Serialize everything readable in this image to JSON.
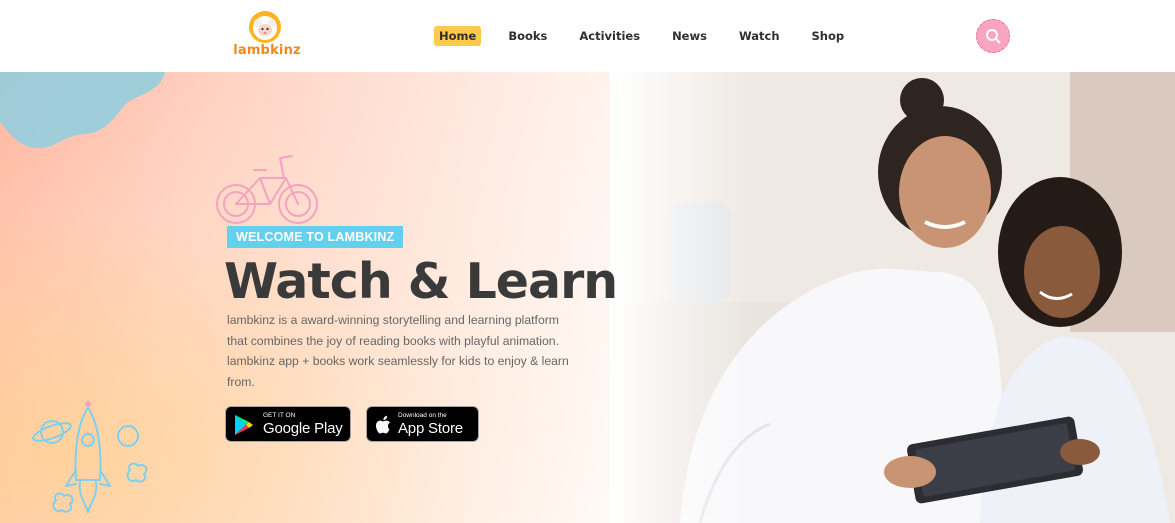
{
  "brand": {
    "name": "lambkinz"
  },
  "nav": {
    "items": [
      {
        "label": "Home",
        "active": true
      },
      {
        "label": "Books",
        "active": false
      },
      {
        "label": "Activities",
        "active": false
      },
      {
        "label": "News",
        "active": false
      },
      {
        "label": "Watch",
        "active": false
      },
      {
        "label": "Shop",
        "active": false
      }
    ]
  },
  "search": {
    "icon": "search-icon"
  },
  "hero": {
    "badge": "WELCOME TO LAMBKINZ",
    "title": "Watch & Learn",
    "description": "lambkinz is a award-winning storytelling and learning platform that combines the joy of reading books with playful animation. lambkinz app + books work seamlessly for kids to enjoy & learn from."
  },
  "stores": {
    "google_play": {
      "small": "GET IT ON",
      "big": "Google Play"
    },
    "app_store": {
      "small": "Download on the",
      "big": "App Store"
    }
  },
  "colors": {
    "accent_yellow": "#ffc94b",
    "badge_blue": "#63d0ee",
    "search_pink": "#f7a5c0",
    "brand_orange": "#f08a1c",
    "headline": "#3a3a3a"
  }
}
